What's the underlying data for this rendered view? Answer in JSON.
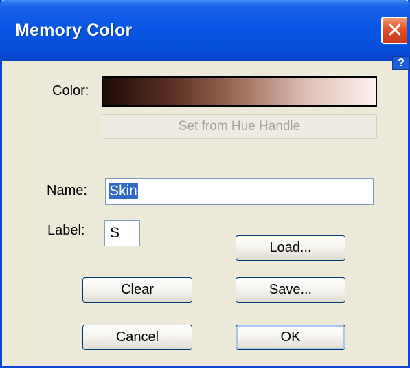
{
  "window": {
    "title": "Memory Color",
    "close_glyph": "✕",
    "help_glyph": "?",
    "icons": {
      "close": "close-icon",
      "help": "help-icon"
    },
    "colors": {
      "titlebar": "#0755e3",
      "window_bg": "#ece9d8",
      "close": "#e0532b",
      "selection": "#316ac5"
    }
  },
  "color_row": {
    "label": "Color:",
    "gradient_colors": [
      "#1c0c08",
      "#5a3022",
      "#a06e5c",
      "#dfc0b4",
      "#fdf1ee"
    ],
    "set_button_label": "Set from Hue Handle"
  },
  "name_row": {
    "label": "Name:",
    "value": "Skin"
  },
  "label_row": {
    "label": "Label:",
    "value": "S"
  },
  "buttons": {
    "load": "Load...",
    "clear": "Clear",
    "save": "Save...",
    "cancel": "Cancel",
    "ok": "OK"
  }
}
